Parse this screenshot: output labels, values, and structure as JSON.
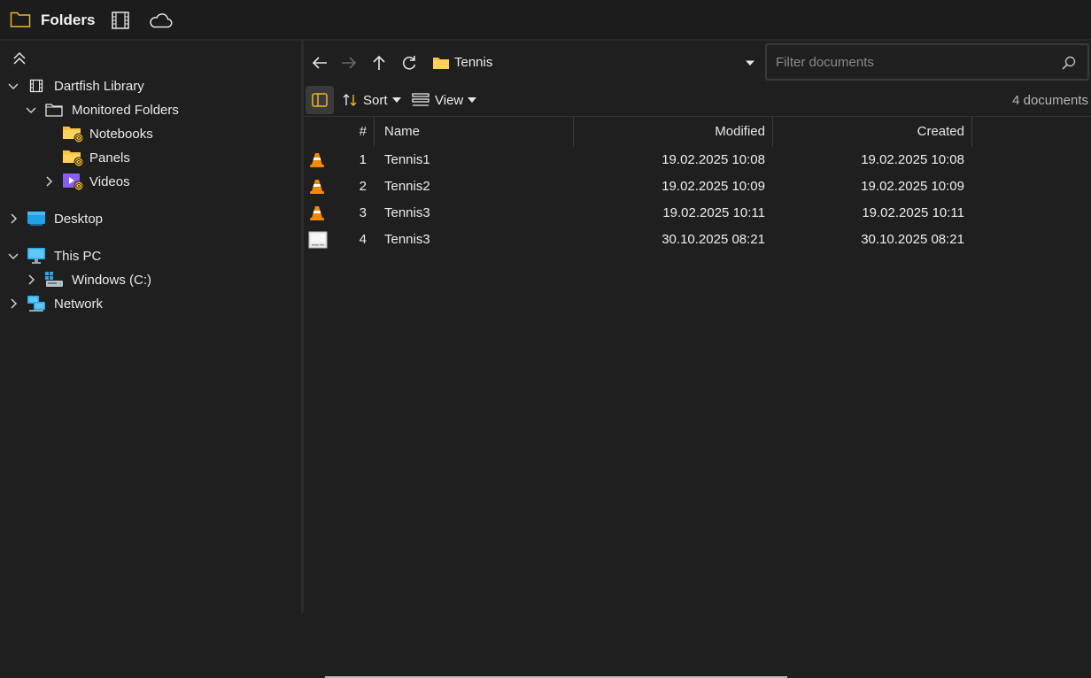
{
  "header": {
    "title": "Folders",
    "icons": [
      "folder-icon",
      "film-icon",
      "cloud-icon"
    ],
    "accent": "#f0b429"
  },
  "sidebar": {
    "items": [
      {
        "label": "Dartfish Library",
        "icon": "film-icon",
        "expanded": true
      },
      {
        "label": "Monitored Folders",
        "icon": "folder-outline-icon",
        "expanded": true
      },
      {
        "label": "Notebooks",
        "icon": "monitored-folder-icon"
      },
      {
        "label": "Panels",
        "icon": "monitored-folder-icon"
      },
      {
        "label": "Videos",
        "icon": "video-folder-icon",
        "expanded": false
      },
      {
        "label": "Desktop",
        "icon": "desktop-icon",
        "expanded": false
      },
      {
        "label": "This PC",
        "icon": "monitor-icon",
        "expanded": true
      },
      {
        "label": "Windows (C:)",
        "icon": "drive-icon",
        "expanded": false
      },
      {
        "label": "Network",
        "icon": "network-icon",
        "expanded": false
      }
    ]
  },
  "nav": {
    "path_label": "Tennis",
    "filter_placeholder": "Filter documents"
  },
  "toolbar": {
    "sort_label": "Sort",
    "view_label": "View",
    "doc_count": "4 documents"
  },
  "table": {
    "columns": [
      "#",
      "Name",
      "Modified",
      "Created"
    ],
    "rows": [
      {
        "num": "1",
        "name": "Tennis1",
        "modified": "19.02.2025 10:08",
        "created": "19.02.2025 10:08",
        "icon": "vlc-icon"
      },
      {
        "num": "2",
        "name": "Tennis2",
        "modified": "19.02.2025 10:09",
        "created": "19.02.2025 10:09",
        "icon": "vlc-icon"
      },
      {
        "num": "3",
        "name": "Tennis3",
        "modified": "19.02.2025 10:11",
        "created": "19.02.2025 10:11",
        "icon": "vlc-icon"
      },
      {
        "num": "4",
        "name": "Tennis3",
        "modified": "30.10.2025 08:21",
        "created": "30.10.2025 08:21",
        "icon": "document-icon"
      }
    ]
  }
}
